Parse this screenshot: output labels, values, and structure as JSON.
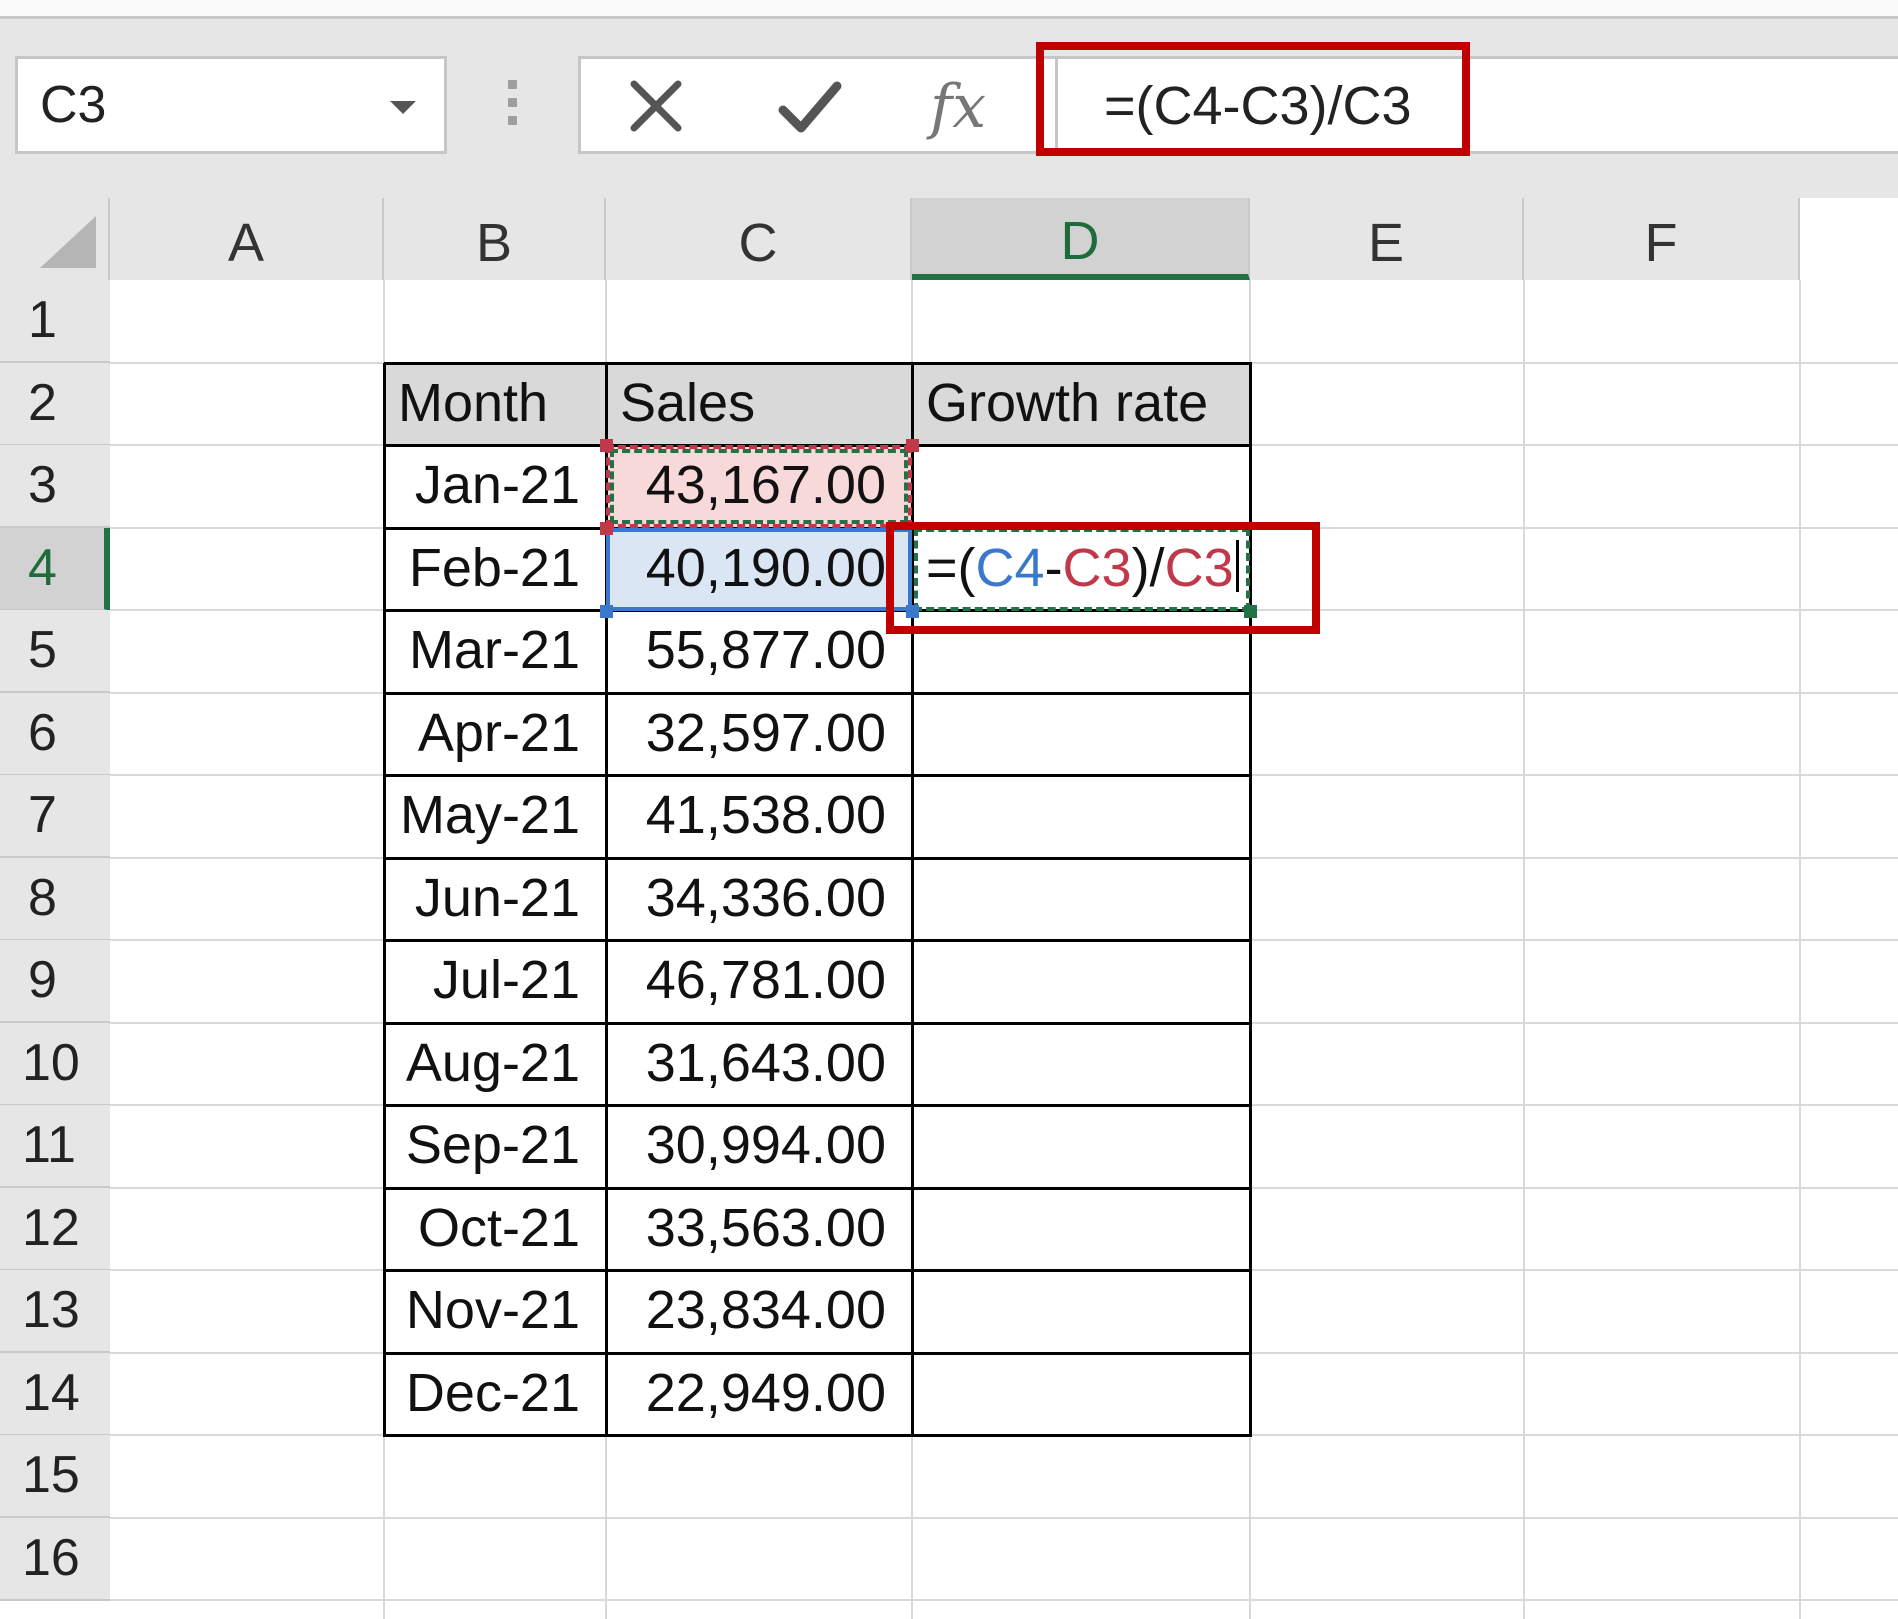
{
  "formula_bar": {
    "name_box": "C3",
    "formula": "=(C4-C3)/C3",
    "fx_label": "fx"
  },
  "columns": [
    "A",
    "B",
    "C",
    "D",
    "E",
    "F"
  ],
  "active_column": "D",
  "rows": [
    "1",
    "2",
    "3",
    "4",
    "5",
    "6",
    "7",
    "8",
    "9",
    "10",
    "11",
    "12",
    "13",
    "14",
    "15",
    "16"
  ],
  "active_row": "4",
  "table": {
    "headers": [
      "Month",
      "Sales",
      "Growth rate"
    ],
    "rows": [
      {
        "month": "Jan-21",
        "sales": "43,167.00"
      },
      {
        "month": "Feb-21",
        "sales": "40,190.00"
      },
      {
        "month": "Mar-21",
        "sales": "55,877.00"
      },
      {
        "month": "Apr-21",
        "sales": "32,597.00"
      },
      {
        "month": "May-21",
        "sales": "41,538.00"
      },
      {
        "month": "Jun-21",
        "sales": "34,336.00"
      },
      {
        "month": "Jul-21",
        "sales": "46,781.00"
      },
      {
        "month": "Aug-21",
        "sales": "31,643.00"
      },
      {
        "month": "Sep-21",
        "sales": "30,994.00"
      },
      {
        "month": "Oct-21",
        "sales": "33,563.00"
      },
      {
        "month": "Nov-21",
        "sales": "23,834.00"
      },
      {
        "month": "Dec-21",
        "sales": "22,949.00"
      }
    ]
  },
  "editing_cell": {
    "parts": [
      "=(",
      "C4",
      "-",
      "C3",
      ")/",
      "C3"
    ]
  },
  "colors": {
    "annotation": "#c00000",
    "ref_c4": "#3a78d0",
    "ref_c3": "#c0394a",
    "excel_green": "#217346"
  }
}
